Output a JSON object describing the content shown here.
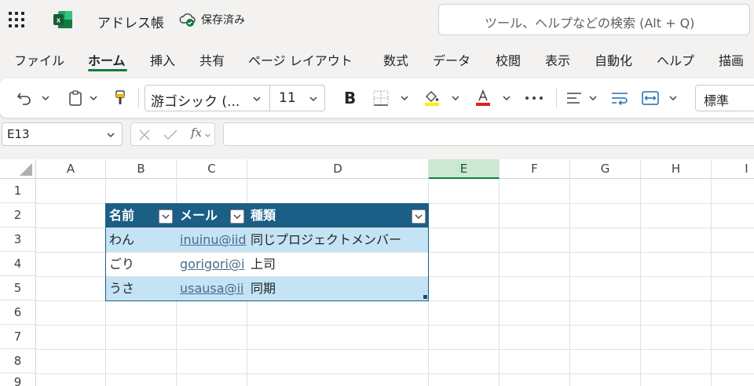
{
  "app": {
    "doc_title": "アドレス帳",
    "save_status": "保存済み",
    "search_placeholder": "ツール、ヘルプなどの検索 (Alt + Q)"
  },
  "ribbon_tabs": [
    {
      "label": "ファイル"
    },
    {
      "label": "ホーム",
      "active": true
    },
    {
      "label": "挿入"
    },
    {
      "label": "共有"
    },
    {
      "label": "ページ レイアウト"
    },
    {
      "label": "数式"
    },
    {
      "label": "データ"
    },
    {
      "label": "校閲"
    },
    {
      "label": "表示"
    },
    {
      "label": "自動化"
    },
    {
      "label": "ヘルプ"
    },
    {
      "label": "描画"
    }
  ],
  "toolbar": {
    "font_name": "游ゴシック (...",
    "font_size": "11",
    "bold_glyph": "B",
    "number_format": "標準",
    "font_color": "#e0201b",
    "fill_color": "#ffee00"
  },
  "formula_bar": {
    "name_box": "E13",
    "fx_label": "fx",
    "formula": ""
  },
  "grid": {
    "columns": [
      "A",
      "B",
      "C",
      "D",
      "E",
      "F",
      "G",
      "H",
      "I"
    ],
    "selected_column": "E",
    "rows": [
      "1",
      "2",
      "3",
      "4",
      "5",
      "6",
      "7",
      "8",
      "9"
    ]
  },
  "table": {
    "headers": [
      "名前",
      "メール",
      "種類"
    ],
    "rows": [
      {
        "name": "わん",
        "email": "inuinu@iid",
        "kind": "同じプロジェクトメンバー"
      },
      {
        "name": "ごり",
        "email": "gorigori@i",
        "kind": "上司"
      },
      {
        "name": "うさ",
        "email": "usausa@ii",
        "kind": "同期"
      }
    ],
    "header_color": "#1b5e86",
    "band_color": "#c4e4f5"
  }
}
